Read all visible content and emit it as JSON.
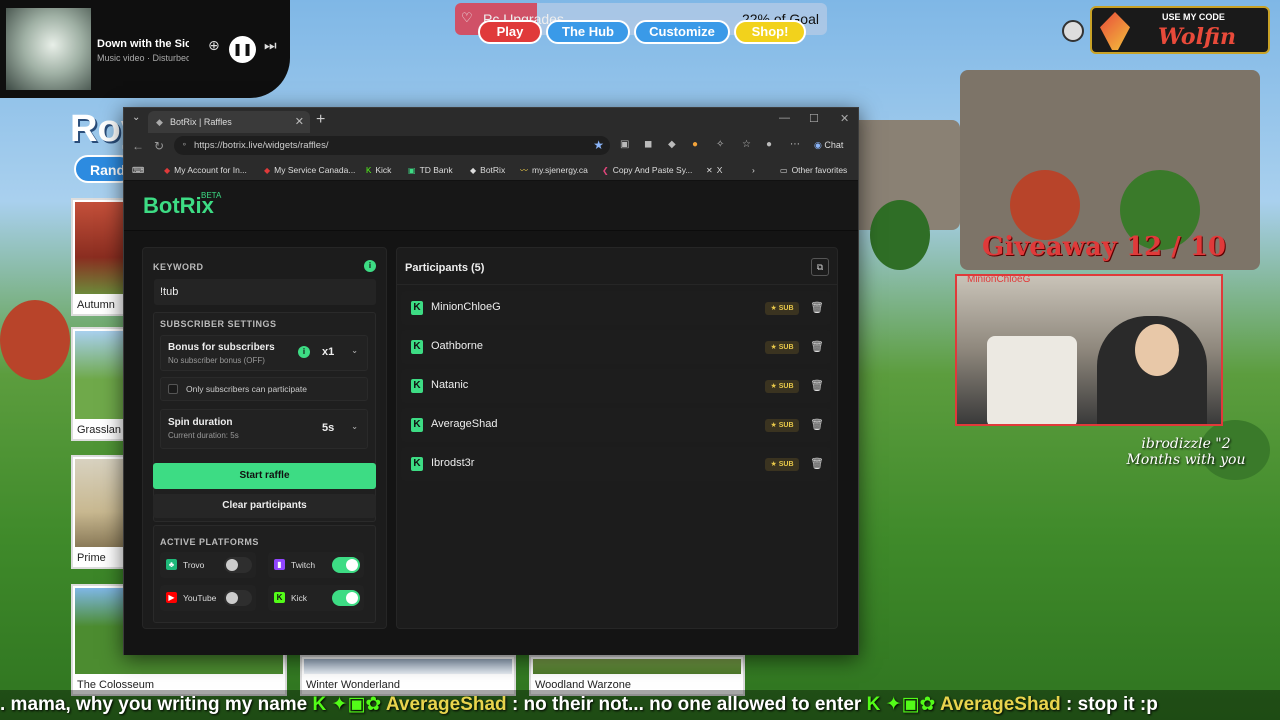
{
  "music": {
    "title": "Down with the Sickness",
    "subtitle": "Music video · Disturbed"
  },
  "topnav": {
    "goal_label": "Pc Upgrades",
    "goal_percent": "22% of Goal",
    "goal_progress": 0.22,
    "pills": [
      "Play",
      "The Hub",
      "Customize",
      "Shop!"
    ]
  },
  "creator_code": {
    "prefix": "USE MY CODE",
    "name": "Wolfin"
  },
  "game": {
    "title": "Roy",
    "mode_button": "Rand",
    "maps": [
      "Autumn",
      "Grasslan",
      "Prime",
      "The Colosseum",
      "Winter Wonderland",
      "Woodland Warzone"
    ]
  },
  "giveaway": "Giveaway 12 / 10",
  "webcam_name": "MinionChloeG",
  "sub_message": "ibrodizzle \"2 Months with you",
  "ticker": {
    "part1": ". mama, why you writing my name",
    "user1": "AverageShad",
    "msg1": ":  no their not... no one allowed to enter",
    "user2": "AverageShad",
    "msg2": ":  stop it :p"
  },
  "browser": {
    "tab_title": "BotRix | Raffles",
    "url": "https://botrix.live/widgets/raffles/",
    "chat_label": "Chat",
    "bookmarks": [
      "My Account for In...",
      "My Service Canada...",
      "Kick",
      "TD Bank",
      "BotRix",
      "my.sjenergy.ca",
      "Copy And Paste Sy...",
      "X"
    ],
    "other_favorites": "Other favorites"
  },
  "botrix": {
    "logo": "BotRix",
    "beta": "BETA",
    "keyword_label": "KEYWORD",
    "keyword_value": "!tub",
    "subscriber_settings_label": "SUBSCRIBER SETTINGS",
    "bonus_title": "Bonus for subscribers",
    "bonus_sub": "No subscriber bonus (OFF)",
    "bonus_value": "x1",
    "only_subs_label": "Only subscribers can participate",
    "spin_title": "Spin duration",
    "spin_sub": "Current duration: 5s",
    "spin_value": "5s",
    "start_button": "Start raffle",
    "clear_button": "Clear participants",
    "active_platforms_label": "ACTIVE PLATFORMS",
    "platforms": [
      {
        "name": "Trovo",
        "enabled": false,
        "color": "#1fb97a"
      },
      {
        "name": "Twitch",
        "enabled": true,
        "color": "#9146ff"
      },
      {
        "name": "YouTube",
        "enabled": false,
        "color": "#ff0000"
      },
      {
        "name": "Kick",
        "enabled": true,
        "color": "#53fc18"
      }
    ],
    "participants_title": "Participants (5)",
    "participants": [
      {
        "name": "MinionChloeG",
        "badge": "SUB"
      },
      {
        "name": "Oathborne",
        "badge": "SUB"
      },
      {
        "name": "Natanic",
        "badge": "SUB"
      },
      {
        "name": "AverageShad",
        "badge": "SUB"
      },
      {
        "name": "Ibrodst3r",
        "badge": "SUB"
      }
    ],
    "accent_color": "#3ddc84"
  }
}
